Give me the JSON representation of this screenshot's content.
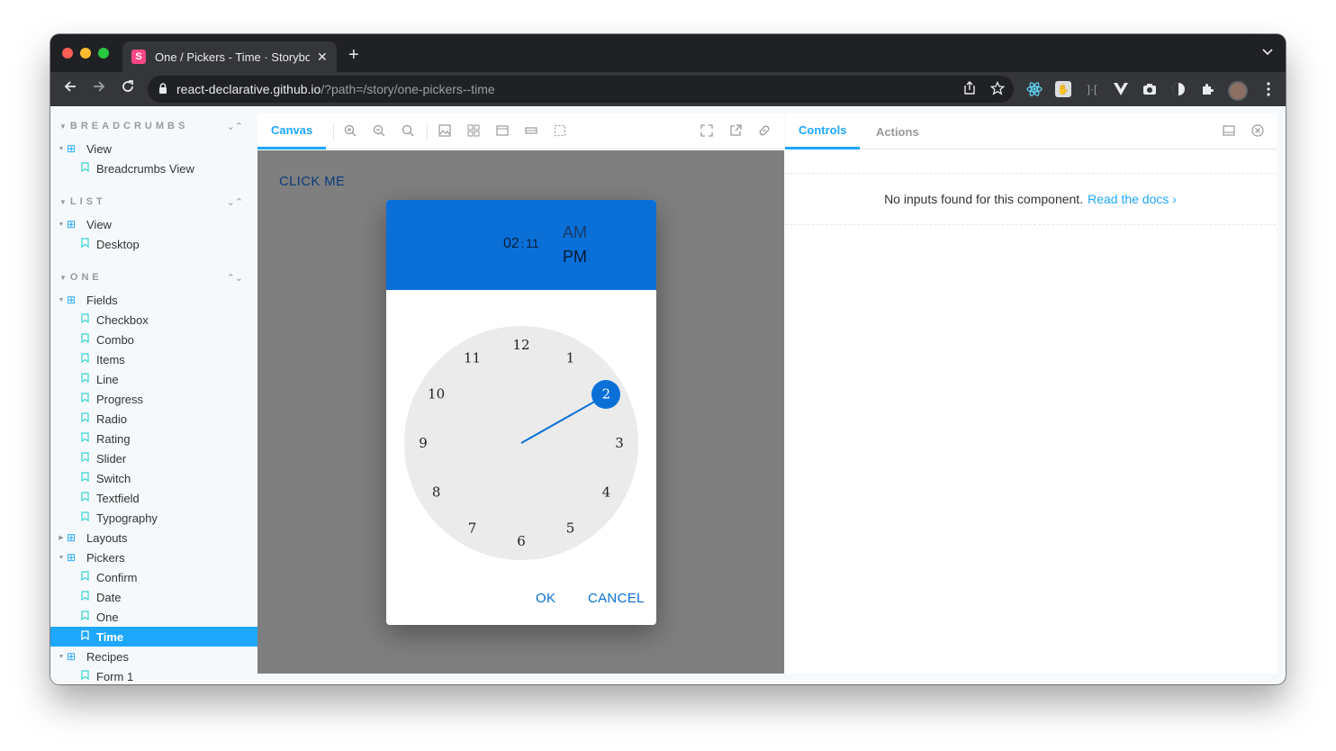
{
  "browser": {
    "tab_title": "One / Pickers - Time · Storybook",
    "favicon_letter": "S",
    "close_glyph": "✕",
    "new_tab_glyph": "+",
    "tab_menu_glyph": "⌄",
    "url_host": "react-declarative.github.io",
    "url_path": "/?path=/story/one-pickers--time"
  },
  "sidebar": {
    "sections": [
      {
        "title": "BREADCRUMBS",
        "toggle": "⌃⌄"
      },
      {
        "title": "LIST",
        "toggle": "⌃⌄"
      },
      {
        "title": "ONE",
        "toggle": "⌃⌄"
      }
    ],
    "breadcrumbs_items": [
      {
        "label": "View",
        "type": "group"
      },
      {
        "label": "Breadcrumbs View",
        "type": "story"
      }
    ],
    "list_items": [
      {
        "label": "View",
        "type": "group"
      },
      {
        "label": "Desktop",
        "type": "story"
      }
    ],
    "one_items": [
      {
        "label": "Fields",
        "type": "group"
      },
      {
        "label": "Checkbox",
        "type": "story"
      },
      {
        "label": "Combo",
        "type": "story"
      },
      {
        "label": "Items",
        "type": "story"
      },
      {
        "label": "Line",
        "type": "story"
      },
      {
        "label": "Progress",
        "type": "story"
      },
      {
        "label": "Radio",
        "type": "story"
      },
      {
        "label": "Rating",
        "type": "story"
      },
      {
        "label": "Slider",
        "type": "story"
      },
      {
        "label": "Switch",
        "type": "story"
      },
      {
        "label": "Textfield",
        "type": "story"
      },
      {
        "label": "Typography",
        "type": "story"
      },
      {
        "label": "Layouts",
        "type": "group"
      },
      {
        "label": "Pickers",
        "type": "group"
      },
      {
        "label": "Confirm",
        "type": "story"
      },
      {
        "label": "Date",
        "type": "story"
      },
      {
        "label": "One",
        "type": "story"
      },
      {
        "label": "Time",
        "type": "story",
        "selected": true
      },
      {
        "label": "Recipes",
        "type": "group"
      },
      {
        "label": "Form 1",
        "type": "story"
      }
    ]
  },
  "canvas": {
    "tab_canvas": "Canvas",
    "click_me": "CLICK ME"
  },
  "time_picker": {
    "hours": "02",
    "separator": ":",
    "minutes": "11",
    "am": "AM",
    "pm": "PM",
    "selected_number": "2",
    "clock_numbers": [
      "12",
      "1",
      "2",
      "3",
      "4",
      "5",
      "6",
      "7",
      "8",
      "9",
      "10",
      "11"
    ],
    "ok": "OK",
    "cancel": "CANCEL"
  },
  "controls": {
    "tab_controls": "Controls",
    "tab_actions": "Actions",
    "empty_message": "No inputs found for this component.",
    "docs_link": "Read the docs ›"
  },
  "colors": {
    "accent": "#1ea7fd",
    "picker_blue": "#0a70d8",
    "preview_bg": "#7f7f7f"
  }
}
